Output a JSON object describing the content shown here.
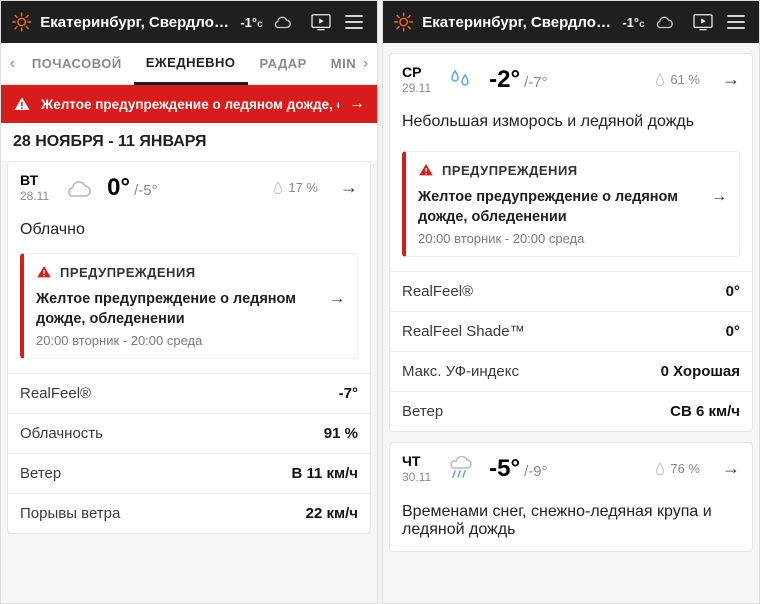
{
  "header": {
    "location": "Екатеринбург, Свердловск",
    "temp_now": "-1°",
    "unit_suffix": "c"
  },
  "tabs": {
    "hourly": "ПОЧАСОВОЙ",
    "daily": "ЕЖЕДНЕВНО",
    "radar": "РАДАР",
    "min": "MIN"
  },
  "alert_top": {
    "text": "Желтое предупреждение о ледяном дожде, облед"
  },
  "date_range": "28 НОЯБРЯ - 11 ЯНВАРЯ",
  "day_tue": {
    "dow": "ВТ",
    "date": "28.11",
    "hi": "0°",
    "lo": "/-5°",
    "precip": "17 %",
    "cond": "Облачно",
    "warn_label": "ПРЕДУПРЕЖДЕНИЯ",
    "warn_title": "Желтое предупреждение о ледяном дожде, обледенении",
    "warn_time": "20:00 вторник - 20:00 среда",
    "details": {
      "realfeel_label": "RealFeel®",
      "realfeel_val": "-7°",
      "cloud_label": "Облачность",
      "cloud_val": "91 %",
      "wind_label": "Ветер",
      "wind_val": "В 11 км/ч",
      "gust_label": "Порывы ветра",
      "gust_val": "22 км/ч"
    }
  },
  "day_wed": {
    "dow": "СР",
    "date": "29.11",
    "hi": "-2°",
    "lo": "/-7°",
    "precip": "61 %",
    "cond": "Небольшая изморось и ледяной дождь",
    "warn_label": "ПРЕДУПРЕЖДЕНИЯ",
    "warn_title": "Желтое предупреждение о ледяном дожде, обледенении",
    "warn_time": "20:00 вторник - 20:00 среда",
    "details": {
      "realfeel_label": "RealFeel®",
      "realfeel_val": "0°",
      "shade_label": "RealFeel Shade™",
      "shade_val": "0°",
      "uv_label": "Макс. УФ-индекс",
      "uv_val": "0 Хорошая",
      "wind_label": "Ветер",
      "wind_val": "СВ 6 км/ч"
    }
  },
  "day_thu": {
    "dow": "ЧТ",
    "date": "30.11",
    "hi": "-5°",
    "lo": "/-9°",
    "precip": "76 %",
    "cond": "Временами снег, снежно-ледяная крупа и ледяной дождь"
  }
}
